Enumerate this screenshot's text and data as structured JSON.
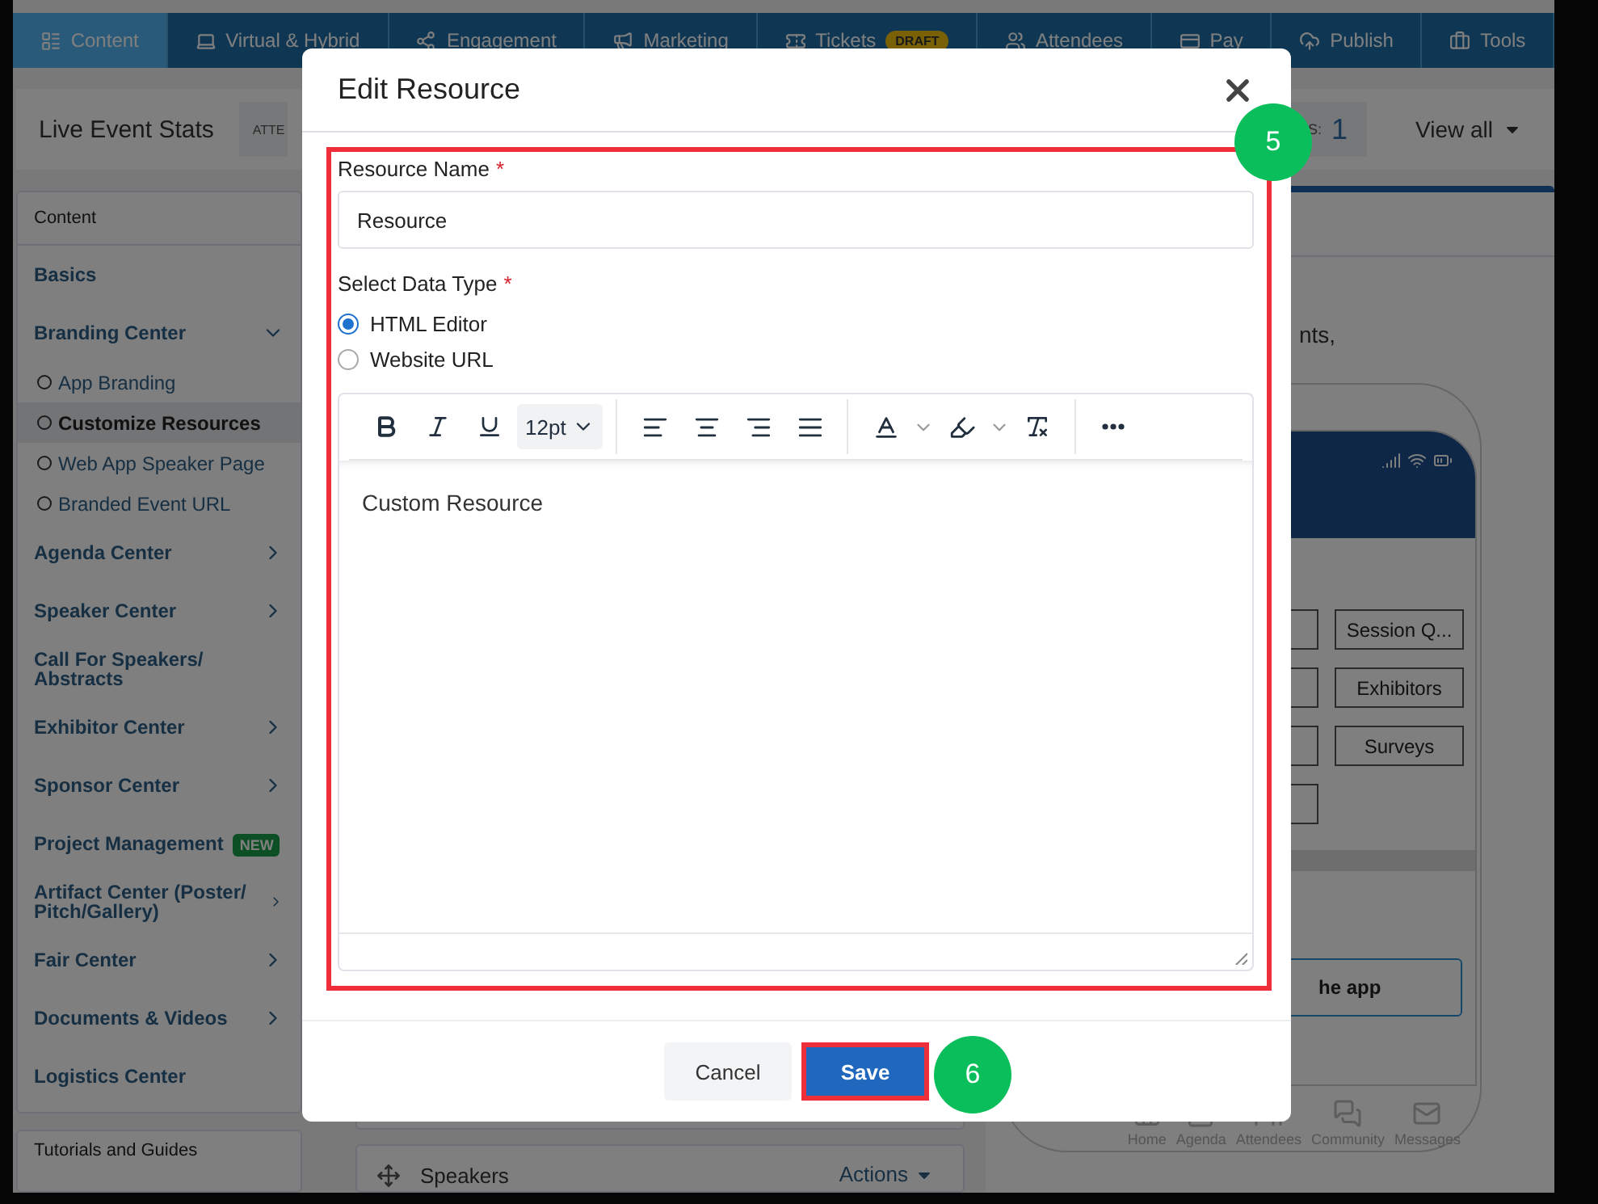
{
  "nav": {
    "tabs": [
      {
        "label": "Content",
        "selected": true
      },
      {
        "label": "Virtual & Hybrid",
        "selected": false
      },
      {
        "label": "Engagement",
        "selected": false
      },
      {
        "label": "Marketing",
        "selected": false
      },
      {
        "label": "Tickets",
        "badge": "DRAFT",
        "selected": false
      },
      {
        "label": "Attendees",
        "selected": false
      },
      {
        "label": "Pay",
        "selected": false
      },
      {
        "label": "Publish",
        "selected": false
      },
      {
        "label": "Tools",
        "selected": false
      }
    ]
  },
  "stats": {
    "title": "Live Event Stats",
    "label": "ATTE",
    "count_label": "S:",
    "count": "1",
    "view_all": "View all"
  },
  "sidebar": {
    "header": "Content",
    "items": [
      {
        "label": "Basics",
        "kind": "link"
      },
      {
        "label": "Branding Center",
        "kind": "group",
        "expanded": true,
        "children": [
          {
            "label": "App Branding",
            "selected": false
          },
          {
            "label": "Customize Resources",
            "selected": true
          },
          {
            "label": "Web App Speaker Page",
            "selected": false
          },
          {
            "label": "Branded Event URL",
            "selected": false
          }
        ]
      },
      {
        "label": "Agenda Center",
        "kind": "group",
        "expanded": false
      },
      {
        "label": "Speaker Center",
        "kind": "group",
        "expanded": false
      },
      {
        "label": "Call For Speakers/ Abstracts",
        "kind": "link"
      },
      {
        "label": "Exhibitor Center",
        "kind": "group",
        "expanded": false
      },
      {
        "label": "Sponsor Center",
        "kind": "group",
        "expanded": false
      },
      {
        "label": "Project Management",
        "kind": "link",
        "badge": "NEW"
      },
      {
        "label": "Artifact Center (Poster/ Pitch/Gallery)",
        "kind": "group",
        "expanded": false
      },
      {
        "label": "Fair Center",
        "kind": "group",
        "expanded": false
      },
      {
        "label": "Documents & Videos",
        "kind": "group",
        "expanded": false
      },
      {
        "label": "Logistics Center",
        "kind": "link"
      }
    ],
    "footer_card": "Tutorials and Guides"
  },
  "main": {
    "card": {
      "title": "Speakers",
      "actions": "Actions"
    }
  },
  "preview": {
    "text": "nts,",
    "tiles": [
      "Session Q...",
      "Exhibitors",
      "Surveys"
    ],
    "app_button": "he app",
    "tabbar": [
      {
        "label": "Home"
      },
      {
        "label": "Agenda"
      },
      {
        "label": "Attendees"
      },
      {
        "label": "Community"
      },
      {
        "label": "Messages"
      }
    ]
  },
  "modal": {
    "title": "Edit Resource",
    "fields": [
      {
        "label": "Resource Name",
        "mark": "*",
        "value": "Resource"
      },
      {
        "label": "Select Data Type",
        "mark": "*"
      }
    ],
    "options": [
      {
        "label": "HTML Editor",
        "selected": true
      },
      {
        "label": "Website URL",
        "selected": false
      }
    ],
    "font_size": "12pt",
    "content": "Custom Resource",
    "cancel": "Cancel",
    "save": "Save",
    "steps": [
      "5",
      "6"
    ]
  }
}
